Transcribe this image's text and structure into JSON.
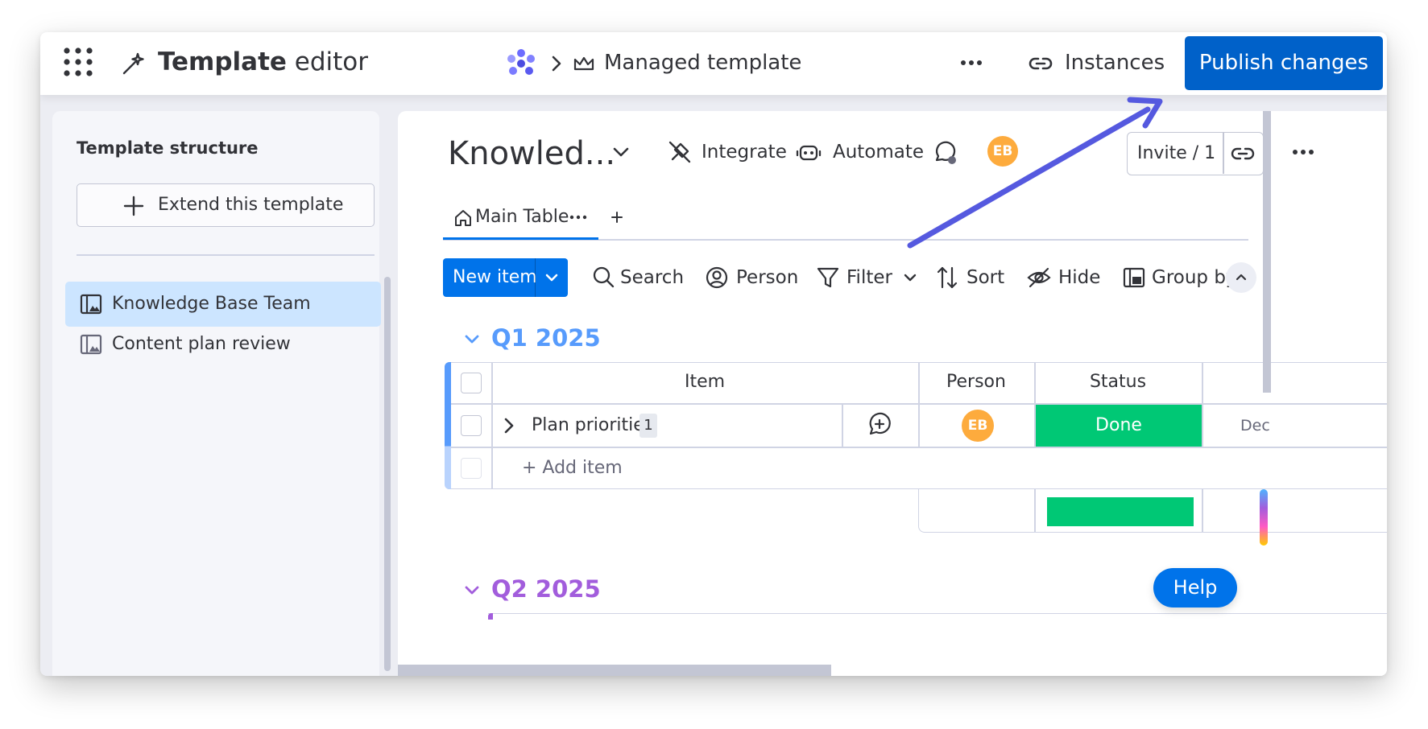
{
  "topbar": {
    "title_bold": "Template",
    "title_rest": " editor",
    "breadcrumb": "Managed template",
    "instances_label": "Instances",
    "publish_label": "Publish changes"
  },
  "sidebar": {
    "title": "Template structure",
    "extend_label": "Extend this template",
    "items": [
      {
        "label": "Knowledge Base Team",
        "selected": true
      },
      {
        "label": "Content plan review",
        "selected": false
      }
    ]
  },
  "board": {
    "title": "Knowled...",
    "integrate_label": "Integrate",
    "automate_label": "Automate",
    "avatar_initials": "EB",
    "invite_label": "Invite / 1",
    "tabs": [
      {
        "label": "Main Table"
      }
    ],
    "toolbar": {
      "new_item": "New item",
      "search": "Search",
      "person": "Person",
      "filter": "Filter",
      "sort": "Sort",
      "hide": "Hide",
      "group_by": "Group by"
    },
    "groups": [
      {
        "title": "Q1 2025",
        "color": "#579bfc",
        "columns": [
          "Item",
          "Person",
          "Status"
        ],
        "rows": [
          {
            "item": "Plan priorities",
            "subitems": "1",
            "person": "EB",
            "status": "Done",
            "status_color": "#00c875",
            "date": "Dec"
          }
        ],
        "add_item_label": "+ Add item"
      },
      {
        "title": "Q2 2025",
        "color": "#a25ddc"
      }
    ]
  },
  "help_label": "Help",
  "colors": {
    "publish": "#0061c9",
    "primary": "#0073ea",
    "done": "#00c875",
    "annotation_arrow": "#5559df"
  }
}
